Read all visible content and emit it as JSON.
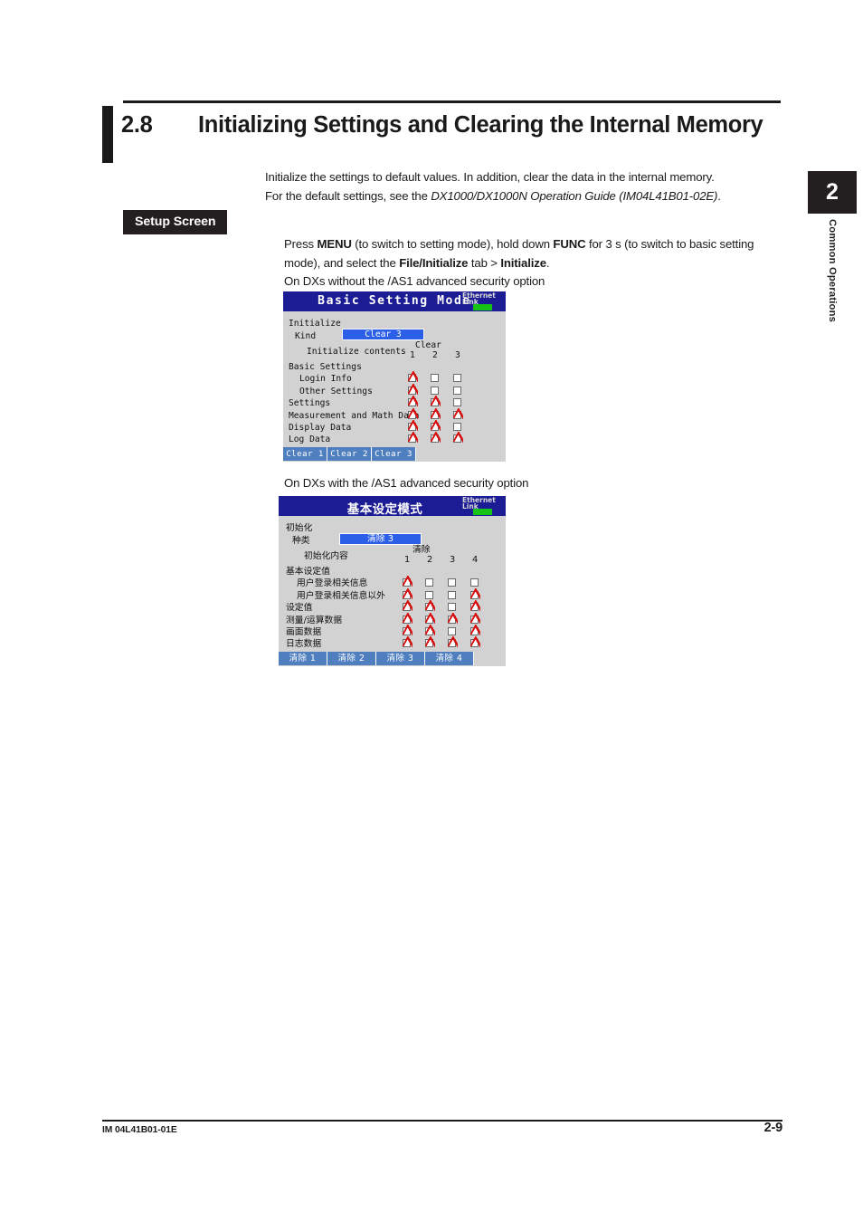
{
  "header": {
    "section_number": "2.8",
    "section_title": "Initializing Settings and Clearing the Internal Memory"
  },
  "intro": {
    "line1": "Initialize the settings to default values. In addition, clear the data in the internal memory.",
    "line2_prefix": "For the default settings, see the ",
    "line2_italic": "DX1000/DX1000N Operation Guide (IM04L41B01-02E)",
    "line2_suffix": "."
  },
  "setup_screen": {
    "label": "Setup Screen",
    "instruction_p1": "Press ",
    "instruction_b1": "MENU",
    "instruction_p2": " (to switch to setting mode), hold down ",
    "instruction_b2": "FUNC",
    "instruction_p3": " for 3 s (to switch to basic setting mode), and select the ",
    "instruction_b3": "File/Initialize",
    "instruction_p4": " tab > ",
    "instruction_b4": "Initialize",
    "instruction_p5": ".",
    "caption1": "On DXs without the /AS1 advanced security option",
    "caption2": "On DXs with the /AS1 advanced security option"
  },
  "device_en": {
    "title": "Basic Setting Mode",
    "ethernet_line1": "Ethernet",
    "ethernet_line2": "Link",
    "initialize_label": "Initialize",
    "kind_label": "Kind",
    "kind_value": "Clear 3",
    "contents_label": "Initialize contents",
    "clear_header": "Clear",
    "columns": [
      "1",
      "2",
      "3"
    ],
    "rows": [
      {
        "label": "Basic Settings",
        "indent": 0,
        "checks": []
      },
      {
        "label": "Login Info",
        "indent": 1,
        "checks": [
          true,
          false,
          false
        ]
      },
      {
        "label": "Other Settings",
        "indent": 1,
        "checks": [
          true,
          false,
          false
        ]
      },
      {
        "label": "Settings",
        "indent": 0,
        "checks": [
          true,
          true,
          false
        ]
      },
      {
        "label": "Measurement and Math Data",
        "indent": 0,
        "checks": [
          true,
          true,
          true
        ]
      },
      {
        "label": "Display Data",
        "indent": 0,
        "checks": [
          true,
          true,
          false
        ]
      },
      {
        "label": "Log Data",
        "indent": 0,
        "checks": [
          true,
          true,
          true
        ]
      }
    ],
    "buttons": [
      "Clear 1",
      "Clear 2",
      "Clear 3"
    ]
  },
  "device_cn": {
    "title": "基本设定模式",
    "ethernet_line1": "Ethernet",
    "ethernet_line2": "Link",
    "initialize_label": "初始化",
    "kind_label": "种类",
    "kind_value": "清除 3",
    "contents_label": "初始化内容",
    "clear_header": "清除",
    "columns": [
      "1",
      "2",
      "3",
      "4"
    ],
    "rows": [
      {
        "label": "基本设定值",
        "indent": 0,
        "checks": []
      },
      {
        "label": "用户登录相关信息",
        "indent": 1,
        "checks": [
          true,
          false,
          false,
          false
        ]
      },
      {
        "label": "用户登录相关信息以外",
        "indent": 1,
        "checks": [
          true,
          false,
          false,
          true
        ]
      },
      {
        "label": "设定值",
        "indent": 0,
        "checks": [
          true,
          true,
          false,
          true
        ]
      },
      {
        "label": "测量/运算数据",
        "indent": 0,
        "checks": [
          true,
          true,
          true,
          true
        ]
      },
      {
        "label": "画面数据",
        "indent": 0,
        "checks": [
          true,
          true,
          false,
          true
        ]
      },
      {
        "label": "日志数据",
        "indent": 0,
        "checks": [
          true,
          true,
          true,
          true
        ]
      }
    ],
    "buttons": [
      "清除 1",
      "清除 2",
      "清除 3",
      "清除 4"
    ]
  },
  "chapter_tab": {
    "number": "2",
    "label": "Common Operations"
  },
  "footer": {
    "doc_id": "IM 04L41B01-01E",
    "page": "2-9"
  },
  "colors": {
    "titlebar": "#1c1c94",
    "screen_bg": "#d2d2d2",
    "highlight": "#2b5fe8",
    "button": "#4f7fbf",
    "check": "#d81010",
    "led": "#16c216",
    "black": "#231f20"
  }
}
